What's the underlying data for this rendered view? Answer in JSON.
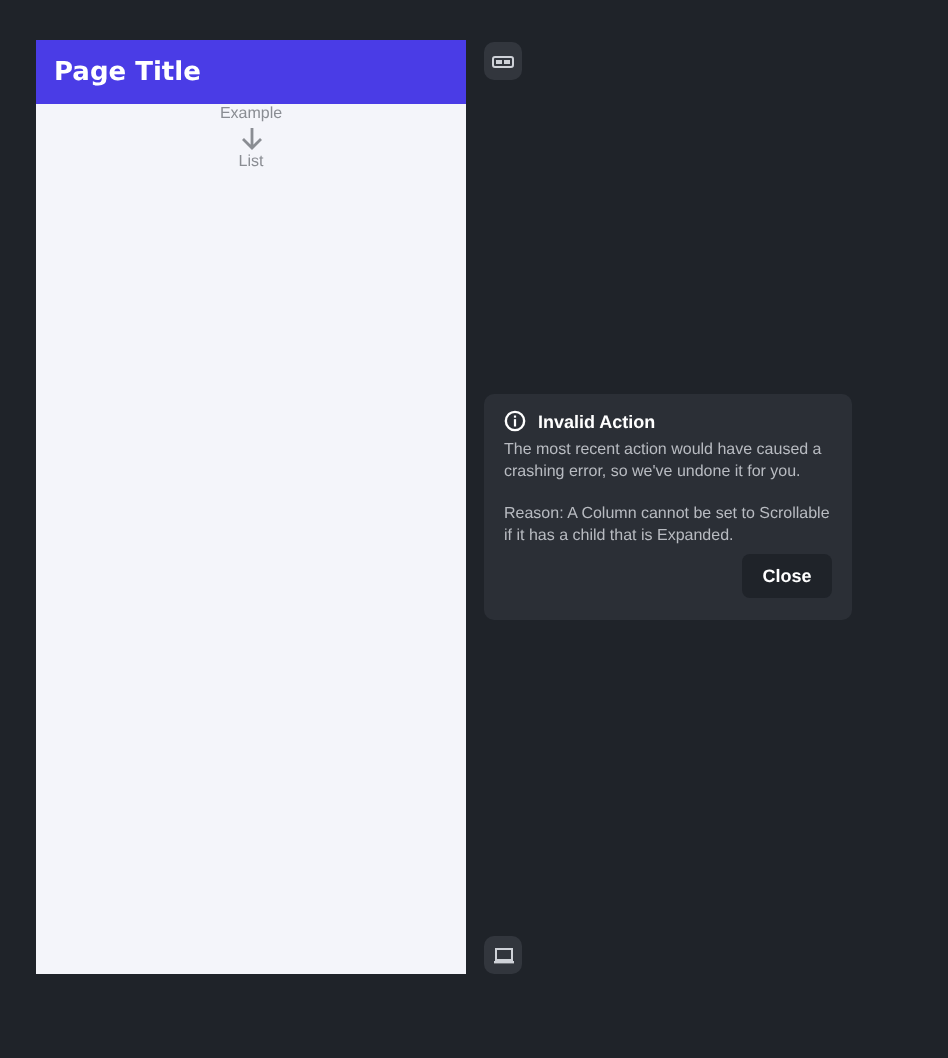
{
  "phone": {
    "app_bar": {
      "title": "Page Title"
    },
    "list": {
      "items": [
        "Example",
        "List"
      ]
    }
  },
  "dialog": {
    "title": "Invalid Action",
    "message": "The most recent action would have caused a crashing error, so we've undone it for you.",
    "reason": "Reason: A Column cannot be set to Scrollable if it has a child that is Expanded.",
    "buttons": [
      "Close"
    ]
  }
}
